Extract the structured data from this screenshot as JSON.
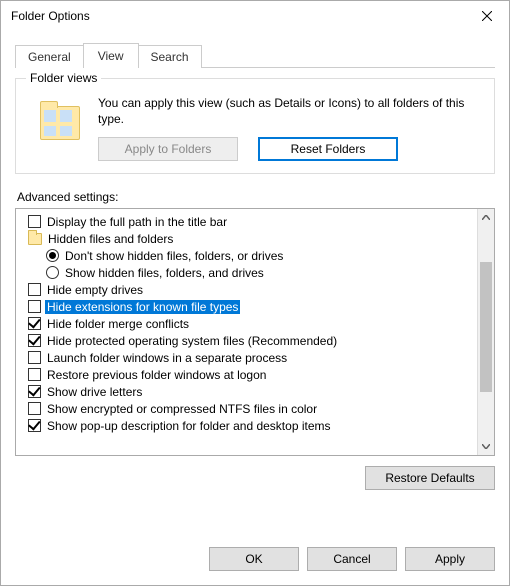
{
  "window": {
    "title": "Folder Options"
  },
  "tabs": {
    "general": "General",
    "view": "View",
    "search": "Search"
  },
  "folder_views": {
    "legend": "Folder views",
    "desc": "You can apply this view (such as Details or Icons) to all folders of this type.",
    "apply": "Apply to Folders",
    "reset": "Reset Folders"
  },
  "adv": {
    "label": "Advanced settings:",
    "items": [
      {
        "kind": "check",
        "checked": false,
        "label": "Display the full path in the title bar",
        "indent": 0,
        "selected": false
      },
      {
        "kind": "folder",
        "label": "Hidden files and folders",
        "indent": 0,
        "selected": false
      },
      {
        "kind": "radio",
        "checked": true,
        "label": "Don't show hidden files, folders, or drives",
        "indent": 1,
        "selected": false
      },
      {
        "kind": "radio",
        "checked": false,
        "label": "Show hidden files, folders, and drives",
        "indent": 1,
        "selected": false
      },
      {
        "kind": "check",
        "checked": false,
        "label": "Hide empty drives",
        "indent": 0,
        "selected": false
      },
      {
        "kind": "check",
        "checked": false,
        "label": "Hide extensions for known file types",
        "indent": 0,
        "selected": true
      },
      {
        "kind": "check",
        "checked": true,
        "label": "Hide folder merge conflicts",
        "indent": 0,
        "selected": false
      },
      {
        "kind": "check",
        "checked": true,
        "label": "Hide protected operating system files (Recommended)",
        "indent": 0,
        "selected": false
      },
      {
        "kind": "check",
        "checked": false,
        "label": "Launch folder windows in a separate process",
        "indent": 0,
        "selected": false
      },
      {
        "kind": "check",
        "checked": false,
        "label": "Restore previous folder windows at logon",
        "indent": 0,
        "selected": false
      },
      {
        "kind": "check",
        "checked": true,
        "label": "Show drive letters",
        "indent": 0,
        "selected": false
      },
      {
        "kind": "check",
        "checked": false,
        "label": "Show encrypted or compressed NTFS files in color",
        "indent": 0,
        "selected": false
      },
      {
        "kind": "check",
        "checked": true,
        "label": "Show pop-up description for folder and desktop items",
        "indent": 0,
        "selected": false
      }
    ]
  },
  "buttons": {
    "restore_defaults": "Restore Defaults",
    "ok": "OK",
    "cancel": "Cancel",
    "apply": "Apply"
  }
}
